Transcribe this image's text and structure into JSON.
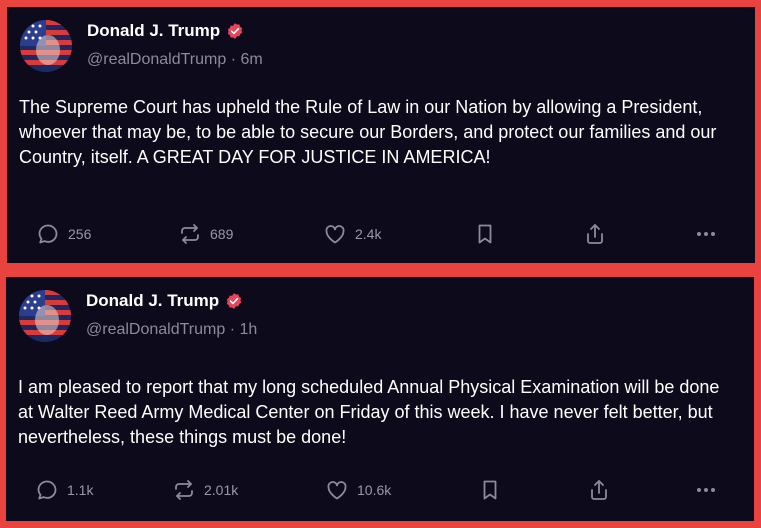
{
  "posts": [
    {
      "author": "Donald J. Trump",
      "handle": "@realDonaldTrump",
      "time": "6m",
      "text": "The Supreme Court has upheld the Rule of Law in our Nation by allowing a President, whoever that may be, to be able to secure our Borders, and protect our families and our Country, itself. A GREAT DAY FOR JUSTICE IN AMERICA!",
      "replies": "256",
      "reposts": "689",
      "likes": "2.4k"
    },
    {
      "author": "Donald J. Trump",
      "handle": "@realDonaldTrump",
      "time": "1h",
      "text": "I am pleased to report that my long scheduled Annual Physical Examination will be done at Walter Reed Army Medical Center on Friday of this week. I have never felt better, but nevertheless, these things must be done!",
      "replies": "1.1k",
      "reposts": "2.01k",
      "likes": "10.6k"
    }
  ],
  "separator": "·",
  "icons": [
    "verified-badge-icon",
    "reply-icon",
    "repost-icon",
    "like-icon",
    "bookmark-icon",
    "share-icon",
    "more-icon"
  ],
  "colors": {
    "background": "#0c0a1b",
    "border": "#e8433f",
    "muted": "#8e8a9e",
    "verified": "#e8455b"
  }
}
